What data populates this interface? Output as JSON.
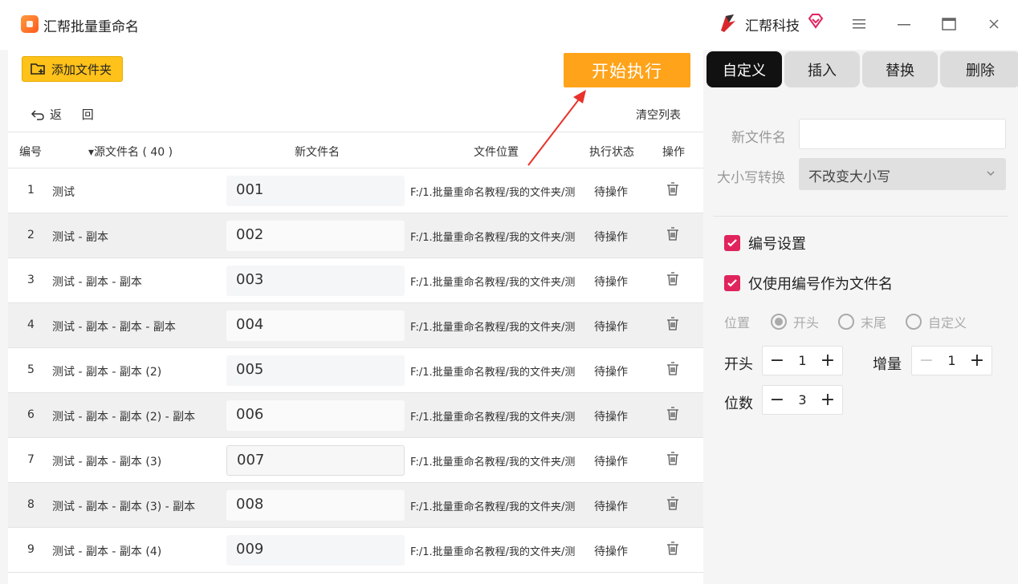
{
  "window": {
    "title": "汇帮批量重命名",
    "brand": "汇帮科技"
  },
  "toolbar": {
    "add_folder": "添加文件夹",
    "start": "开始执行",
    "back": "返 回",
    "clear_list": "清空列表"
  },
  "table": {
    "headers": {
      "num": "编号",
      "source": "▾源文件名 ( 40 )",
      "new_name": "新文件名",
      "location": "文件位置",
      "status": "执行状态",
      "action": "操作"
    },
    "rows": [
      {
        "num": "1",
        "source": "测试",
        "new_name": "001",
        "location": "F:/1.批量重命名教程/我的文件夹/测",
        "status": "待操作"
      },
      {
        "num": "2",
        "source": "测试 - 副本",
        "new_name": "002",
        "location": "F:/1.批量重命名教程/我的文件夹/测",
        "status": "待操作"
      },
      {
        "num": "3",
        "source": "测试 - 副本 - 副本",
        "new_name": "003",
        "location": "F:/1.批量重命名教程/我的文件夹/测",
        "status": "待操作"
      },
      {
        "num": "4",
        "source": "测试 - 副本 - 副本 - 副本",
        "new_name": "004",
        "location": "F:/1.批量重命名教程/我的文件夹/测",
        "status": "待操作"
      },
      {
        "num": "5",
        "source": "测试 - 副本 - 副本 (2)",
        "new_name": "005",
        "location": "F:/1.批量重命名教程/我的文件夹/测",
        "status": "待操作"
      },
      {
        "num": "6",
        "source": "测试 - 副本 - 副本 (2) - 副本",
        "new_name": "006",
        "location": "F:/1.批量重命名教程/我的文件夹/测",
        "status": "待操作"
      },
      {
        "num": "7",
        "source": "测试 - 副本 - 副本 (3)",
        "new_name": "007",
        "location": "F:/1.批量重命名教程/我的文件夹/测",
        "status": "待操作"
      },
      {
        "num": "8",
        "source": "测试 - 副本 - 副本 (3) - 副本",
        "new_name": "008",
        "location": "F:/1.批量重命名教程/我的文件夹/测",
        "status": "待操作"
      },
      {
        "num": "9",
        "source": "测试 - 副本 - 副本 (4)",
        "new_name": "009",
        "location": "F:/1.批量重命名教程/我的文件夹/测",
        "status": "待操作"
      }
    ]
  },
  "right": {
    "tabs": [
      "自定义",
      "插入",
      "替换",
      "删除"
    ],
    "new_name_label": "新文件名",
    "case_label": "大小写转换",
    "case_value": "不改变大小写",
    "numbering_setting": "编号设置",
    "only_number": "仅使用编号作为文件名",
    "position_label": "位置",
    "position_options": [
      "开头",
      "末尾",
      "自定义"
    ],
    "start_label": "开头",
    "start_value": "1",
    "increment_label": "增量",
    "increment_value": "1",
    "digits_label": "位数",
    "digits_value": "3"
  },
  "colors": {
    "accent_orange": "#ffa31a",
    "folder_yellow": "#ffc21a",
    "check_pink": "#e0245e",
    "arrow_red": "#e8322b"
  }
}
